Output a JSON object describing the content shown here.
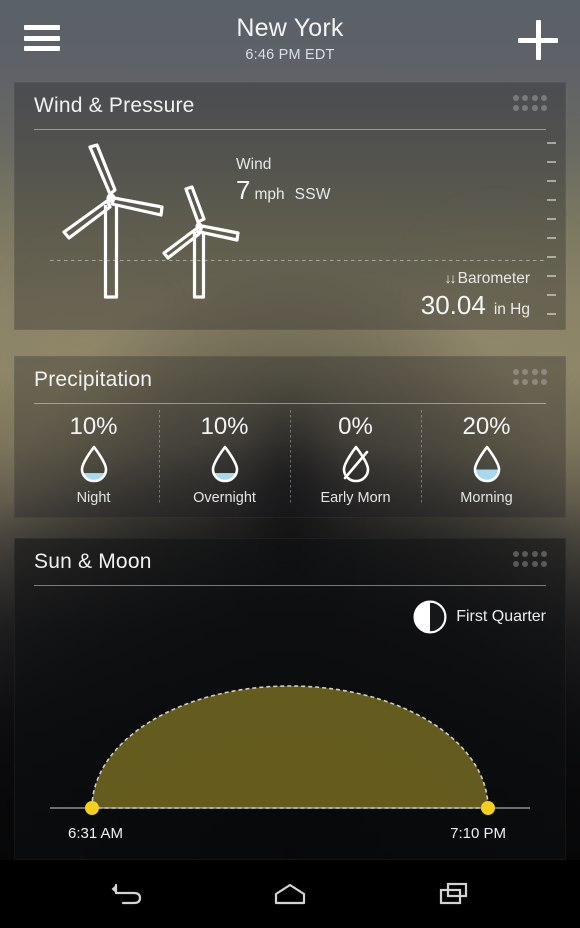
{
  "header": {
    "menu_icon": "hamburger-menu-icon",
    "city": "New York",
    "time": "6:46 PM EDT",
    "add_icon": "plus-icon"
  },
  "cards": {
    "wind": {
      "title": "Wind & Pressure",
      "grip_icon": "drag-handle-icon",
      "turbine_icon": "wind-turbine-icon",
      "wind_label": "Wind",
      "wind_speed": "7",
      "wind_unit": "mph",
      "wind_direction": "SSW",
      "barometer_label": "Barometer",
      "barometer_trend_icon": "double-down-arrow-icon",
      "barometer_trend": "↓↓",
      "barometer_value": "30.04",
      "barometer_unit": "in Hg"
    },
    "precipitation": {
      "title": "Precipitation",
      "grip_icon": "drag-handle-icon",
      "periods": [
        {
          "percent": "10%",
          "label": "Night",
          "fill": 0.18,
          "none": false,
          "icon": "water-drop-icon"
        },
        {
          "percent": "10%",
          "label": "Overnight",
          "fill": 0.18,
          "none": false,
          "icon": "water-drop-icon"
        },
        {
          "percent": "0%",
          "label": "Early Morn",
          "fill": 0.0,
          "none": true,
          "icon": "water-drop-slashed-icon"
        },
        {
          "percent": "20%",
          "label": "Morning",
          "fill": 0.34,
          "none": false,
          "icon": "water-drop-icon"
        }
      ]
    },
    "sun_moon": {
      "title": "Sun & Moon",
      "grip_icon": "drag-handle-icon",
      "moon_phase": "First Quarter",
      "moon_icon": "moon-first-quarter-icon",
      "sunrise": "6:31 AM",
      "sunset": "7:10 PM",
      "arc_fill_color": "#6d6320",
      "arc_border_color": "#cfcfc0",
      "marker_color": "#f5cf1a"
    }
  },
  "navbar": {
    "back": "back-icon",
    "home": "home-icon",
    "recents": "recent-apps-icon"
  }
}
